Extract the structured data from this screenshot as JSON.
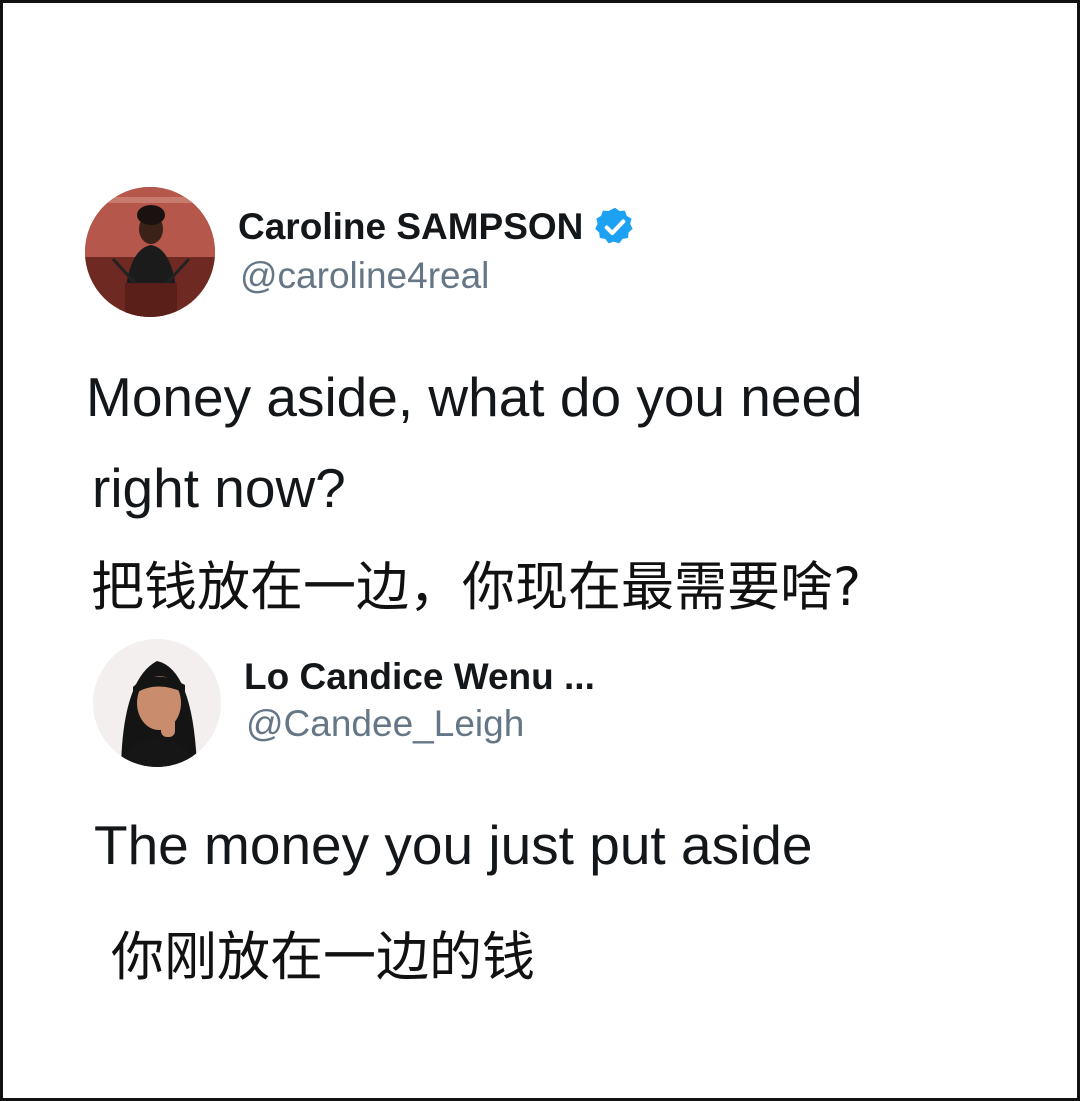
{
  "tweet1": {
    "author_name": "Caroline SAMPSON",
    "verified": true,
    "handle": "@caroline4real",
    "text_line1": "Money aside, what do you need",
    "text_line2": "right now?",
    "translation": "把钱放在一边，你现在最需要啥?"
  },
  "tweet2": {
    "author_name": "Lo Candice Wenu ...",
    "handle": "@Candee_Leigh",
    "text": "The money you just put aside",
    "translation": "你刚放在一边的钱"
  },
  "colors": {
    "name": "#14171a",
    "handle": "#657786",
    "verified_badge": "#1da1f2",
    "border": "#111111"
  },
  "icons": {
    "verified": "verified-badge-icon"
  }
}
